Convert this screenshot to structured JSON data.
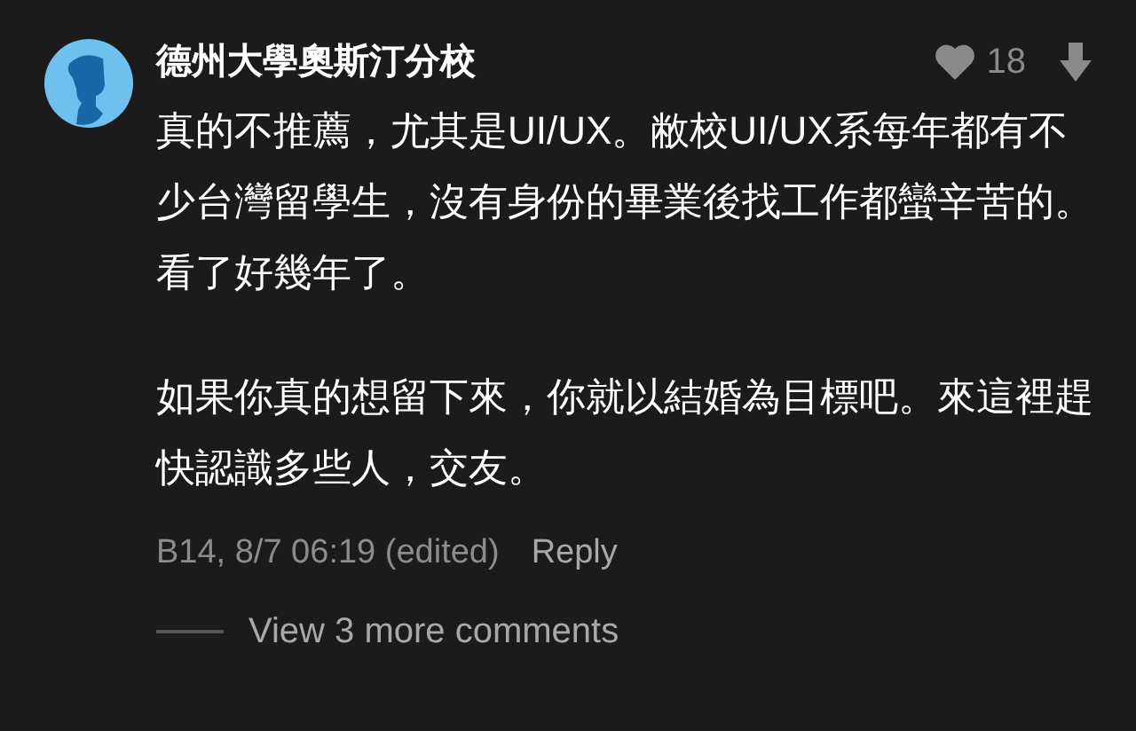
{
  "comment": {
    "author": "德州大學奧斯汀分校",
    "likes": "18",
    "paragraphs": [
      "真的不推薦，尤其是UI/UX。敝校UI/UX系每年都有不少台灣留學生，沒有身份的畢業後找工作都蠻辛苦的。看了好幾年了。",
      "如果你真的想留下來，你就以結婚為目標吧。來這裡趕快認識多些人，交友。"
    ],
    "meta": "B14, 8/7 06:19 (edited)",
    "reply": "Reply",
    "more": "View 3 more comments"
  }
}
